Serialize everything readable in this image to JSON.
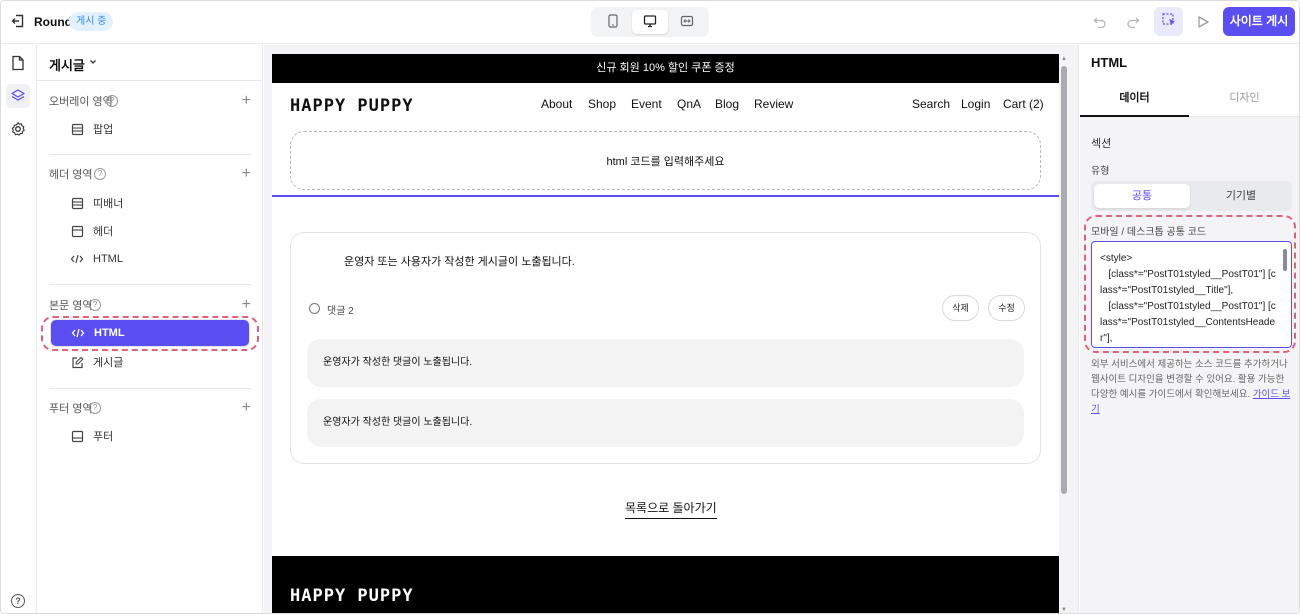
{
  "topbar": {
    "site_name": "Round",
    "status": "게시 중",
    "publish_label": "사이트 게시"
  },
  "panel": {
    "title": "게시글",
    "sections": {
      "overlay": {
        "label": "오버레이 영역",
        "items": [
          "팝업"
        ]
      },
      "header": {
        "label": "헤더 영역",
        "items": [
          "띠배너",
          "헤더",
          "HTML"
        ]
      },
      "body": {
        "label": "본문 영역",
        "items": [
          "HTML",
          "게시글"
        ]
      },
      "footer": {
        "label": "푸터 영역",
        "items": [
          "푸터"
        ]
      }
    },
    "help_glyph": "?"
  },
  "preview": {
    "announcement": "신규 회원 10% 할인 쿠폰 증정",
    "logo": "HAPPY PUPPY",
    "nav_left": [
      "About",
      "Shop",
      "Event",
      "QnA",
      "Blog",
      "Review"
    ],
    "nav_right": [
      "Search",
      "Login",
      "Cart (2)"
    ],
    "html_placeholder": "html 코드를 입력해주세요",
    "post_text": "운영자 또는 사용자가 작성한 게시글이 노출됩니다.",
    "comment_count": "댓글 2",
    "delete_label": "삭제",
    "edit_label": "수정",
    "comments": [
      "운영자가 작성한 댓글이 노출됩니다.",
      "운영자가 작성한 댓글이 노출됩니다."
    ],
    "back_link": "목록으로 돌아가기",
    "footer_logo": "HAPPY PUPPY"
  },
  "inspector": {
    "title": "HTML",
    "tabs": [
      "데이터",
      "디자인"
    ],
    "section_label": "섹션",
    "type_label": "유형",
    "type_options": [
      "공통",
      "기기별"
    ],
    "code_label": "모바일 / 데스크톱 공통 코드",
    "code_value": "<style>\n   [class*=\"PostT01styled__PostT01\"] [class*=\"PostT01styled__Title\"],\n   [class*=\"PostT01styled__PostT01\"] [class*=\"PostT01styled__ContentsHeader\"],",
    "help_text": "외부 서비스에서 제공하는 소스 코드를 추가하거나 웹사이트 디자인을 변경할 수 있어요. 활용 가능한 다양한 예시를 가이드에서 확인해보세요.",
    "guide_link": "가이드 보기"
  },
  "colors": {
    "accent": "#5b4ef0",
    "highlight": "#e0607a",
    "badge_bg": "#e3f1ff",
    "badge_text": "#2d8cf0"
  },
  "icons": [
    "back-icon",
    "mobile-icon",
    "desktop-icon",
    "fit-width-icon",
    "undo-icon",
    "redo-icon",
    "select-element-icon",
    "play-icon",
    "page-icon",
    "layers-icon",
    "settings-icon",
    "help-icon",
    "plus-icon",
    "code-icon",
    "popup-icon",
    "post-edit-icon",
    "comment-icon"
  ]
}
